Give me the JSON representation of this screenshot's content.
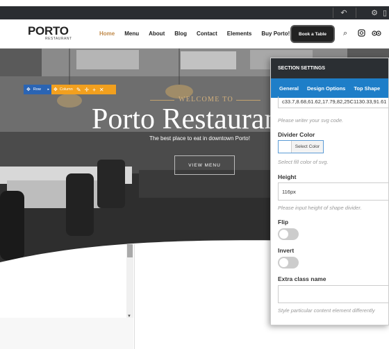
{
  "topbar": {
    "icons": [
      "undo-icon",
      "gear-icon",
      "device-icon"
    ]
  },
  "header": {
    "logo_main": "PORTO",
    "logo_sub": "RESTAURANT",
    "nav": [
      "Home",
      "Menu",
      "About",
      "Blog",
      "Contact",
      "Elements",
      "Buy Porto!"
    ],
    "active_nav": "Home",
    "book_label": "Book a Table",
    "icons": [
      "search-icon",
      "instagram-icon",
      "tripadvisor-icon"
    ]
  },
  "hero": {
    "welcome": "WELCOME TO",
    "title": "Porto Restaurant",
    "subtitle": "The best place to eat in downtown Porto!",
    "button": "VIEW MENU"
  },
  "editor_toolbar": {
    "row_label": "Row",
    "column_label": "Column"
  },
  "panel": {
    "title": "SECTION SETTINGS",
    "tabs": [
      "General",
      "Design Options",
      "Top Shape"
    ],
    "svg_code_value": "c33.7,8.68,61.62,17.79,82,25C1130.33,91.61",
    "svg_code_help": "Please writer your svg code.",
    "divider_color_label": "Divider Color",
    "select_color_label": "Select Color",
    "divider_color_help": "Select fill color of svg.",
    "height_label": "Height",
    "height_value": "116px",
    "height_help": "Please input height of shape divider.",
    "flip_label": "Flip",
    "invert_label": "Invert",
    "extra_class_label": "Extra class name",
    "extra_class_value": "",
    "extra_class_help": "Style particular content element differently"
  },
  "colors": {
    "accent": "#c08a4a",
    "panel_tab": "#1e7ec8",
    "row_blue": "#2a64b4",
    "column_orange": "#f2a01e"
  }
}
